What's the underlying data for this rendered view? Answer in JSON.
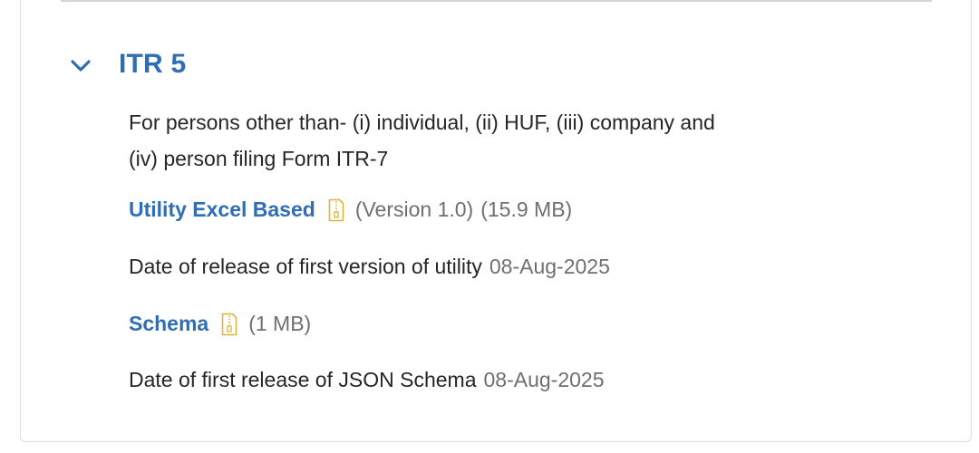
{
  "section": {
    "title": "ITR 5",
    "description_line1": "For persons other than- (i) individual, (ii) HUF, (iii) company and",
    "description_line2": "(iv) person filing Form ITR-7"
  },
  "utility": {
    "link_label": "Utility Excel Based",
    "version": "(Version 1.0)",
    "size": "(15.9 MB)",
    "date_label": "Date of release of first version of utility",
    "date_value": "08-Aug-2025"
  },
  "schema": {
    "link_label": "Schema",
    "size": "(1 MB)",
    "date_label": "Date of first release of JSON Schema",
    "date_value": "08-Aug-2025"
  },
  "icons": {
    "toggle": "chevron-down-icon",
    "download": "zip-file-icon"
  },
  "colors": {
    "link": "#2f6db5",
    "text": "#262626",
    "muted": "#6f6f6f",
    "zip_icon": "#e0b43a",
    "border": "#dcdcdc"
  }
}
